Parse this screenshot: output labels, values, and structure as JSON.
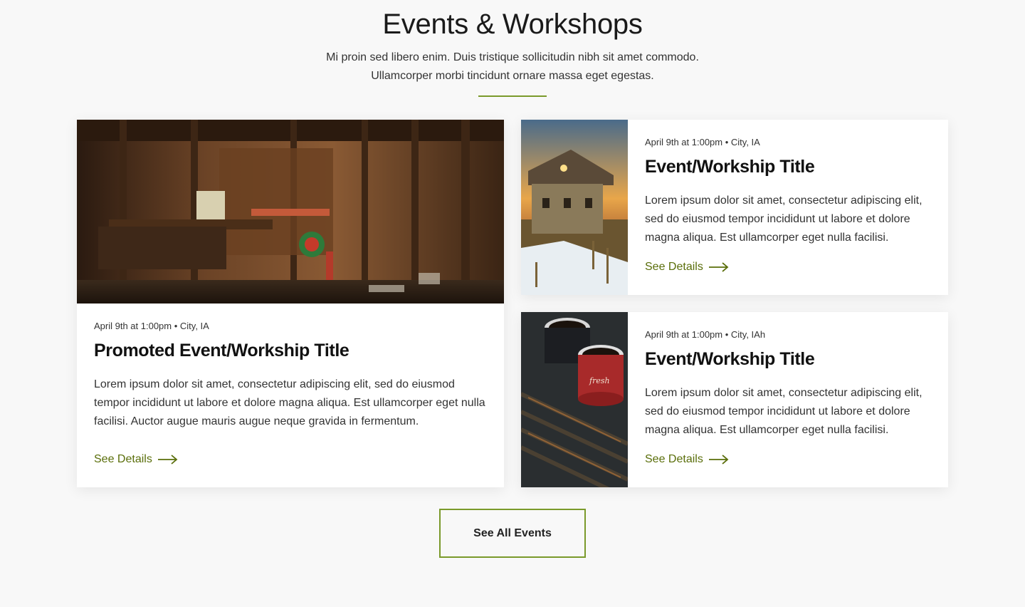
{
  "header": {
    "title": "Events & Workshops",
    "subtitle_line1": "Mi proin sed libero enim. Duis tristique sollicitudin nibh sit amet commodo.",
    "subtitle_line2": "Ullamcorper morbi tincidunt ornare massa eget egestas."
  },
  "colors": {
    "accent": "#7a9a2b",
    "link": "#5a6e0a",
    "background": "#f8f8f8"
  },
  "promoted": {
    "image": "workshop-interior-photo",
    "meta": "April 9th at 1:00pm • City, IA",
    "title": "Promoted Event/Workship Title",
    "description": "Lorem ipsum dolor sit amet, consectetur adipiscing elit, sed do eiusmod tempor incididunt ut labore et dolore magna aliqua. Est ullamcorper eget nulla facilisi. Auctor augue mauris augue neque gravida in fermentum.",
    "link_label": "See Details"
  },
  "events": [
    {
      "image": "old-farmhouse-sunset-photo",
      "meta": "April 9th at 1:00pm • City, IA",
      "title": "Event/Workship Title",
      "description": "Lorem ipsum dolor sit amet, consectetur adipiscing elit, sed do eiusmod tempor incididunt ut labore et dolore magna aliqua. Est ullamcorper eget nulla facilisi.",
      "link_label": "See Details"
    },
    {
      "image": "coffee-mugs-on-grill-photo",
      "meta": "April 9th at 1:00pm • City, IAh",
      "title": "Event/Workship Title",
      "description": "Lorem ipsum dolor sit amet, consectetur adipiscing elit, sed do eiusmod tempor incididunt ut labore et dolore magna aliqua. Est ullamcorper eget nulla facilisi.",
      "link_label": "See Details"
    }
  ],
  "cta": {
    "label": "See All Events"
  }
}
